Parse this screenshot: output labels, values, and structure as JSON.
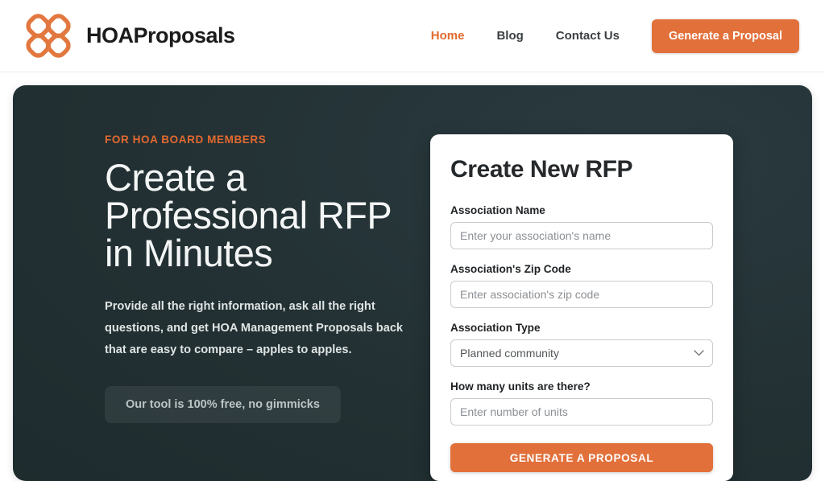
{
  "header": {
    "brand_name": "HOAProposals",
    "logo_icon": "clover-logo-icon",
    "nav": [
      {
        "label": "Home",
        "active": true
      },
      {
        "label": "Blog",
        "active": false
      },
      {
        "label": "Contact Us",
        "active": false
      }
    ],
    "cta_label": "Generate a Proposal"
  },
  "hero": {
    "eyebrow": "FOR HOA BOARD MEMBERS",
    "title_line_1": "Create a",
    "title_line_2": "Professional RFP",
    "title_line_3": "in Minutes",
    "subtitle": "Provide all the right information, ask all the right questions, and get HOA Management Proposals back that are easy to compare – apples to apples.",
    "badge_label": "Our tool is 100% free, no gimmicks"
  },
  "form": {
    "title": "Create New RFP",
    "fields": [
      {
        "label": "Association Name",
        "placeholder": "Enter your association's name",
        "value": "",
        "type": "text"
      },
      {
        "label": "Association's Zip Code",
        "placeholder": "Enter association's zip code",
        "value": "",
        "type": "text"
      },
      {
        "label": "Association Type",
        "value": "Planned community",
        "type": "select",
        "options": [
          "Planned community"
        ]
      },
      {
        "label": "How many units are there?",
        "placeholder": "Enter number of units",
        "value": "",
        "type": "text"
      }
    ],
    "submit_label": "GENERATE A PROPOSAL"
  },
  "colors": {
    "brand_orange": "#E2703A",
    "accent_orange": "#E2692F",
    "hero_dark": "#233134",
    "text_dark": "#1f2224"
  }
}
